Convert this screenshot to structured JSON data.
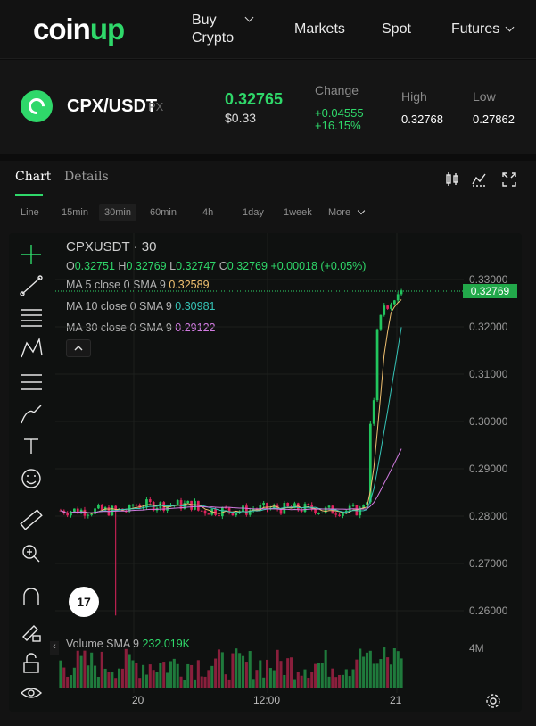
{
  "nav": {
    "logo_white": "coin",
    "logo_green": "up",
    "buy_line1": "Buy",
    "buy_line2": "Crypto",
    "markets": "Markets",
    "spot": "Spot",
    "futures": "Futures"
  },
  "ticker": {
    "pair": "CPX/USDT",
    "pair_ghost": "PX",
    "price": "0.32765",
    "price_usd": "$0.33",
    "change_label": "Change",
    "change_abs": "+0.04555",
    "change_pct": "+16.15%",
    "high_label": "High",
    "high": "0.32768",
    "low_label": "Low",
    "low": "0.27862",
    "accent": "#2fd86a"
  },
  "tabs": {
    "chart": "Chart",
    "details": "Details"
  },
  "timeframes": [
    "Line",
    "15min",
    "30min",
    "60min",
    "4h",
    "1day",
    "1week",
    "More"
  ],
  "timeframe_selected": "30min",
  "chart": {
    "symbol": "CPXUSDT · 30",
    "ohlc": {
      "o_label": "O",
      "o": "0.32751",
      "h_label": "H",
      "h": "0.32769",
      "l_label": "L",
      "l": "0.32747",
      "c_label": "C",
      "c": "0.32769",
      "change": "+0.00018 (+0.05%)"
    },
    "ma5_label": "MA 5 close 0 SMA 9",
    "ma5": "0.32589",
    "ma10_label": "MA 10 close 0 SMA 9",
    "ma10": "0.30981",
    "ma30_label": "MA 30 close 0 SMA 9",
    "ma30": "0.29122",
    "last_price_tag": "0.32769",
    "volume_label": "Volume SMA 9",
    "volume_value": "232.019K",
    "vol_axis": "4M",
    "tv_logo": "17"
  },
  "chart_data": {
    "type": "candlestick",
    "y_ticks": [
      "0.33000",
      "0.32000",
      "0.31000",
      "0.30000",
      "0.29000",
      "0.28000",
      "0.27000",
      "0.26000"
    ],
    "ylim": [
      0.2575,
      0.3335
    ],
    "x_ticks": [
      "20",
      "12:00",
      "21"
    ],
    "colors": {
      "up": "#22c55e",
      "down": "#e0245e",
      "ma5": "#f0c070",
      "ma10": "#36c5b8",
      "ma30": "#d17be0"
    }
  }
}
